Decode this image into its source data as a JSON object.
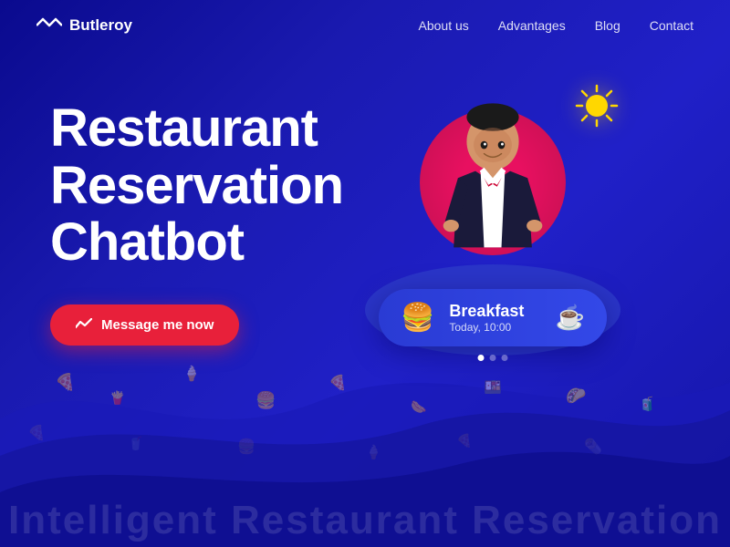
{
  "brand": {
    "name": "Butleroy"
  },
  "nav": {
    "links": [
      "About us",
      "Advantages",
      "Blog",
      "Contact"
    ]
  },
  "hero": {
    "title_line1": "Restaurant",
    "title_line2": "Reservation",
    "title_line3": "Chatbot",
    "cta_label": "Message me now"
  },
  "card": {
    "title": "Breakfast",
    "subtitle": "Today, 10:00"
  },
  "dots": [
    true,
    false,
    false
  ],
  "bottom_text": "Intelligent Restaurant Reservation"
}
